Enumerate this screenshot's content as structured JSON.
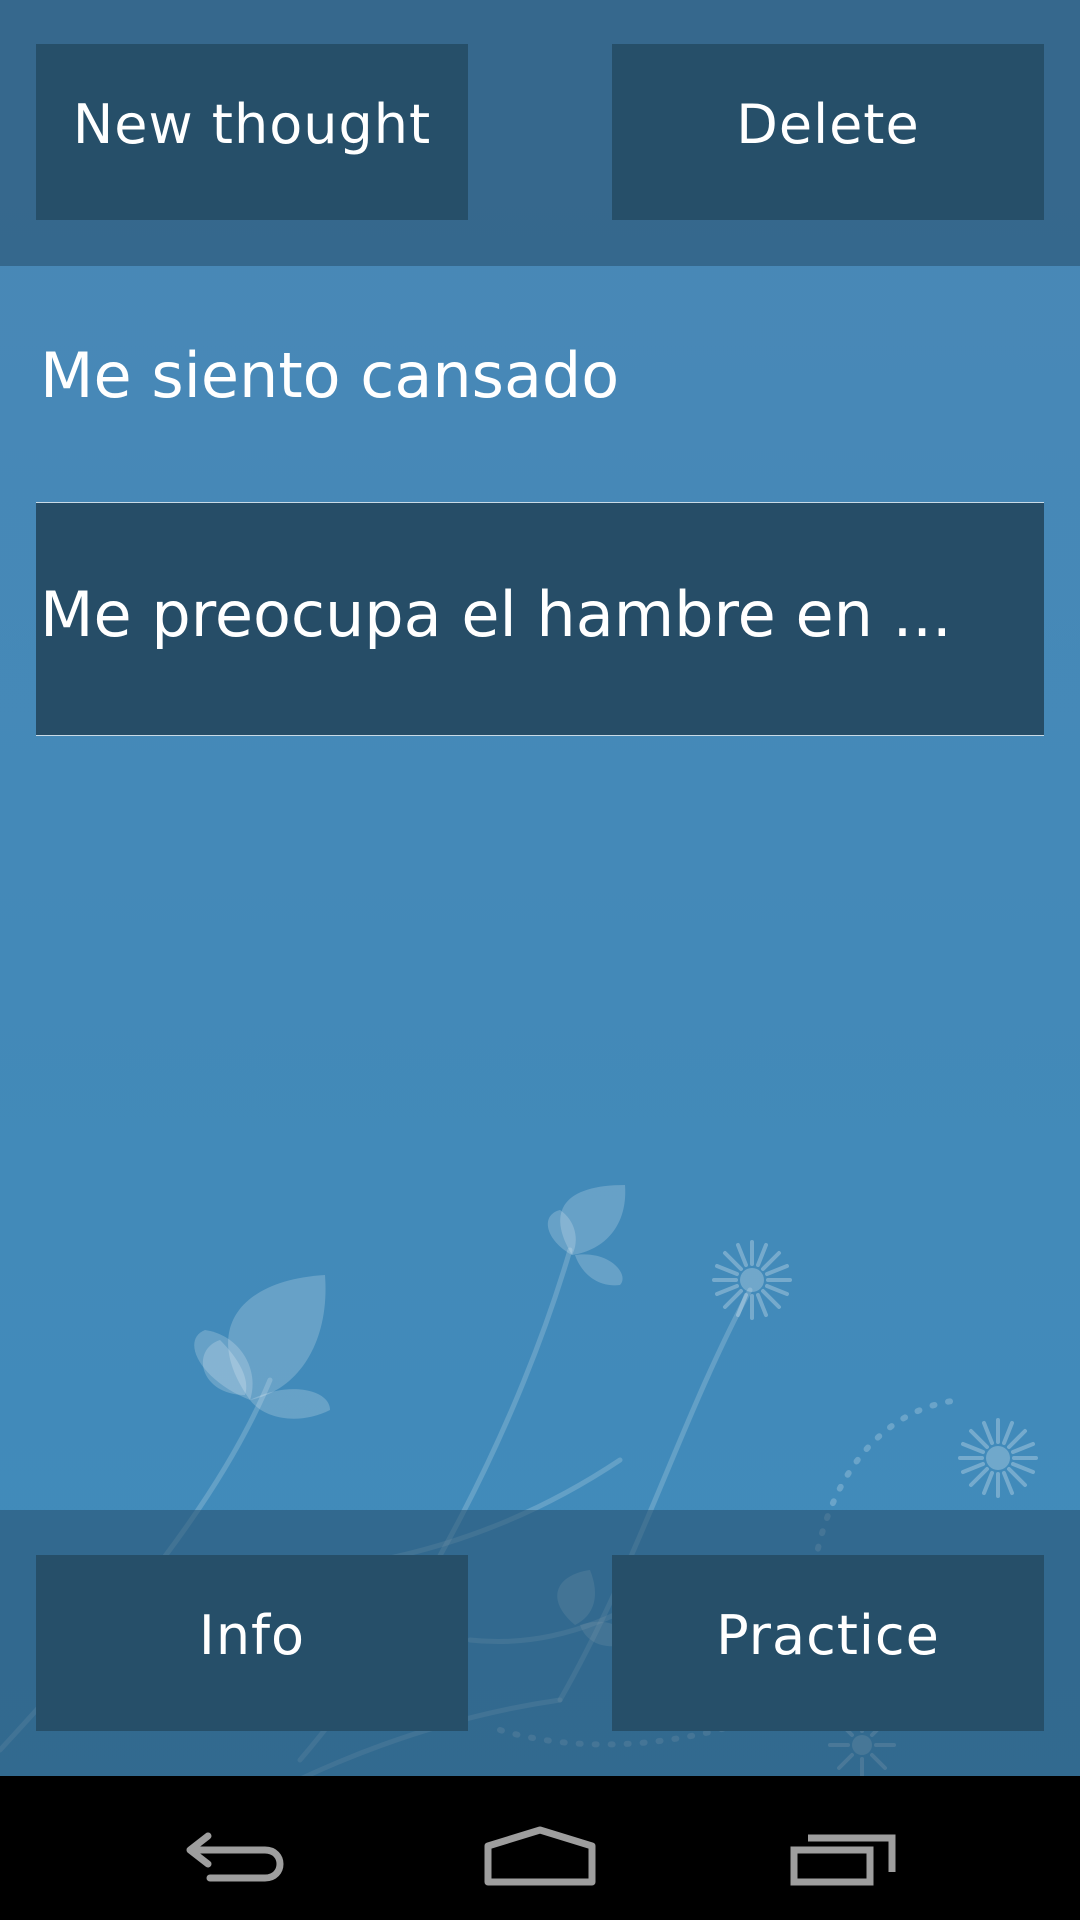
{
  "toolbar": {
    "new_thought_label": "New thought",
    "delete_label": "Delete"
  },
  "content": {
    "heading": "Me siento cansado",
    "thoughts": [
      {
        "text": "Me preocupa el hambre en ..."
      }
    ]
  },
  "footer": {
    "info_label": "Info",
    "practice_label": "Practice"
  },
  "nav": {
    "icons": [
      "back-icon",
      "home-icon",
      "recent-apps-icon"
    ]
  },
  "colors": {
    "background": "#4489b8",
    "bar": "#34688d",
    "button": "#264f69",
    "text": "#ffffff"
  }
}
